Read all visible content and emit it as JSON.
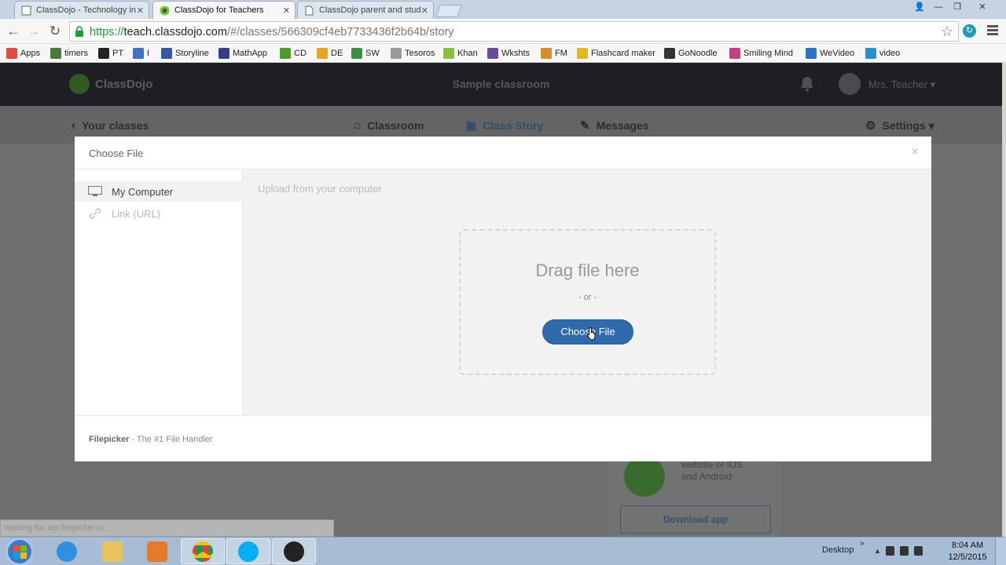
{
  "browser": {
    "tabs": [
      {
        "title": "ClassDojo - Technology in",
        "active": false
      },
      {
        "title": "ClassDojo for Teachers",
        "active": true
      },
      {
        "title": "ClassDojo parent and stud",
        "active": false
      }
    ],
    "url": {
      "scheme": "https://",
      "host": "teach.classdojo.com",
      "path": "/#/classes/566309cf4eb7733436f2b64b/story"
    },
    "window_controls": {
      "minimize": "—",
      "restore": "❐",
      "close": "✕",
      "user": "👤"
    },
    "bookmarks": [
      {
        "label": "Apps",
        "icon": "apps-grid-icon",
        "color": "#e04a3f"
      },
      {
        "label": "timers",
        "icon": "timer-icon",
        "color": "#4a7a3a"
      },
      {
        "label": "PT",
        "icon": "pt-icon",
        "color": "#222222"
      },
      {
        "label": "I",
        "icon": "i-icon",
        "color": "#3b74c8"
      },
      {
        "label": "Storyline",
        "icon": "storyline-icon",
        "color": "#3556a0"
      },
      {
        "label": "MathApp",
        "icon": "mathapp-icon",
        "color": "#3b3b8c"
      },
      {
        "label": "CD",
        "icon": "classdojo-icon",
        "color": "#4e9a2c"
      },
      {
        "label": "DE",
        "icon": "de-icon",
        "color": "#e8a41f"
      },
      {
        "label": "SW",
        "icon": "sw-icon",
        "color": "#3c8f43"
      },
      {
        "label": "Tesoros",
        "icon": "page-icon",
        "color": "#9a9a9a"
      },
      {
        "label": "Khan",
        "icon": "leaf-icon",
        "color": "#8bbf3f"
      },
      {
        "label": "Wkshts",
        "icon": "wkshts-icon",
        "color": "#6a4a9c"
      },
      {
        "label": "FM",
        "icon": "fm-icon",
        "color": "#d98c2b"
      },
      {
        "label": "Flashcard maker",
        "icon": "smiley-icon",
        "color": "#e2b81c"
      },
      {
        "label": "GoNoodle",
        "icon": "gonoodle-icon",
        "color": "#333333"
      },
      {
        "label": "Smiling Mind",
        "icon": "brain-icon",
        "color": "#c23d82"
      },
      {
        "label": "WeVideo",
        "icon": "play-icon",
        "color": "#2b72c9"
      },
      {
        "label": "video",
        "icon": "video-icon",
        "color": "#2b90c9"
      }
    ]
  },
  "classdojo": {
    "logo_text": "ClassDojo",
    "class_name": "Sample classroom",
    "teacher_name": "Mrs. Teacher ▾",
    "nav": {
      "back": "Your classes",
      "classroom": "Classroom",
      "class_story": "Class Story",
      "messages": "Messages",
      "settings": "Settings ▾"
    },
    "app_card": {
      "line1": "website or iOS",
      "line2": "and Android",
      "download": "Download app"
    },
    "status_text": "Waiting for api.filepicker.io..."
  },
  "modal": {
    "title": "Choose File",
    "close": "×",
    "sources": [
      {
        "label": "My Computer",
        "icon": "monitor-icon",
        "active": true
      },
      {
        "label": "Link (URL)",
        "icon": "link-icon",
        "active": false
      }
    ],
    "upload_label": "Upload from your computer",
    "drag_text": "Drag file here",
    "or_text": "- or -",
    "choose_button": "Choose File",
    "footer_brand": "Filepicker",
    "footer_tagline": " - The #1 File Handler",
    "accent_color": "#2f6aad"
  },
  "taskbar": {
    "apps": [
      "internet-explorer-icon",
      "file-explorer-icon",
      "media-player-icon",
      "chrome-icon",
      "skype-icon",
      "obs-icon"
    ],
    "desktop_label": "Desktop",
    "time": "8:04 AM",
    "date": "12/5/2015"
  }
}
